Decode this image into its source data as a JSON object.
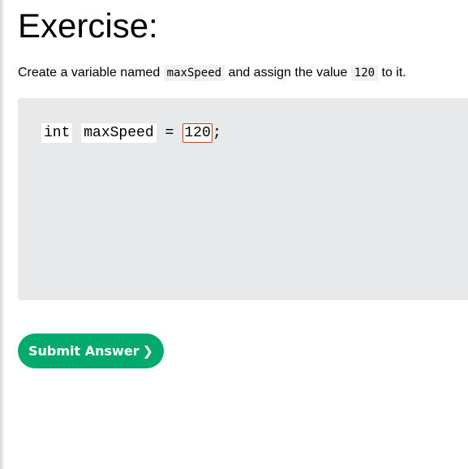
{
  "exercise": {
    "title": "Exercise:",
    "instruction": {
      "text_before": "Create a variable named ",
      "code_variable": "maxSpeed",
      "text_middle": " and assign the value ",
      "code_value": "120",
      "text_after": " to it."
    },
    "code": {
      "type_keyword": "int",
      "variable_name": "maxSpeed",
      "operator": "=",
      "answer_value": "120",
      "terminator": ";"
    },
    "submit_button": {
      "label": "Submit Answer",
      "chevron": "❯"
    },
    "colors": {
      "submit_bg": "#04aa6d",
      "code_panel_bg": "#e7e9eb",
      "input_border": "#c0462a"
    }
  }
}
